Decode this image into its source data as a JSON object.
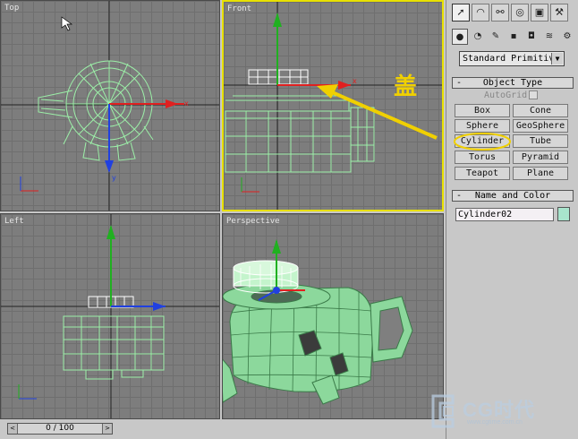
{
  "viewports": {
    "top": {
      "label": "Top"
    },
    "front": {
      "label": "Front"
    },
    "left": {
      "label": "Left"
    },
    "perspective": {
      "label": "Perspective"
    }
  },
  "annotation": {
    "text": "盖",
    "arrow_color": "#f0d000"
  },
  "panel": {
    "tabs": [
      "pointer-icon",
      "create-icon",
      "hierarchy-icon",
      "motion-icon",
      "display-icon",
      "utilities-icon"
    ],
    "subtabs": [
      "geometry-icon",
      "shapes-icon",
      "lights-icon",
      "cameras-icon",
      "helpers-icon",
      "spacewarps-icon",
      "systems-icon"
    ],
    "category": "Standard Primitiv",
    "object_type": {
      "title": "Object Type",
      "autogrid": "AutoGrid",
      "buttons": [
        "Box",
        "Cone",
        "Sphere",
        "GeoSphere",
        "Cylinder",
        "Tube",
        "Torus",
        "Pyramid",
        "Teapot",
        "Plane"
      ],
      "highlighted": "Cylinder"
    },
    "name_color": {
      "title": "Name and Color",
      "name": "Cylinder02",
      "color": "#a8e4cc"
    }
  },
  "timeline": {
    "value": "0 / 100"
  },
  "watermark": {
    "text": "CG时代",
    "url": "www.cgtime.com.cn"
  },
  "colors": {
    "wireframe": "#9cf0a8",
    "axis_x": "#e02020",
    "axis_y": "#20b020",
    "axis_z": "#2040e0",
    "active_border": "#e8e000"
  }
}
